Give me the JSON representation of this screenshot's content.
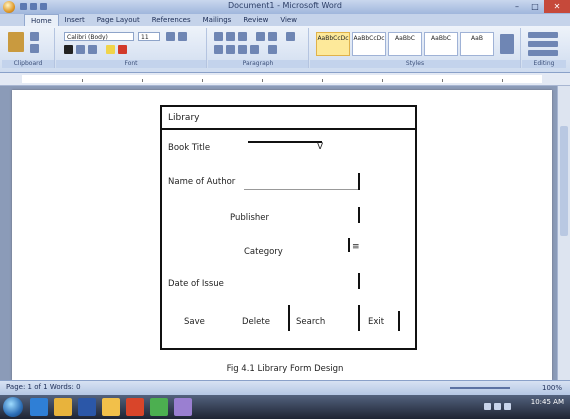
{
  "window": {
    "title": "Document1 - Microsoft Word",
    "controls": {
      "minimize": "–",
      "maximize": "□",
      "close": "✕"
    }
  },
  "ribbon": {
    "tabs": [
      "Home",
      "Insert",
      "Page Layout",
      "References",
      "Mailings",
      "Review",
      "View"
    ],
    "active_tab": "Home",
    "font_name": "Calibri (Body)",
    "font_size": "11",
    "groups": [
      "Clipboard",
      "Font",
      "Paragraph",
      "Styles",
      "Editing"
    ],
    "styles": [
      "AaBbCcDc",
      "AaBbCcDc",
      "AaBbC",
      "AaBbC",
      "AaB"
    ]
  },
  "dialog": {
    "title": "Library",
    "fields": [
      {
        "label": "Book Title"
      },
      {
        "label": "Name of Author"
      },
      {
        "label": "Publisher"
      },
      {
        "label": "Category"
      },
      {
        "label": "Date of Issue"
      }
    ],
    "dropdown_marker": "V",
    "buttons": [
      "Save",
      "Delete",
      "Search",
      "Exit"
    ]
  },
  "caption": "Fig 4.1 Library Form Design",
  "statusbar": {
    "left": "Page: 1 of 1   Words: 0",
    "zoom": "100%"
  },
  "taskbar": {
    "time": "10:45 AM",
    "icons": [
      "ie-icon",
      "explorer-icon",
      "word-icon",
      "folder-icon",
      "media-icon",
      "paint-icon",
      "camera-icon"
    ],
    "icon_colors": [
      "#2f7fd6",
      "#e8b33c",
      "#2b57a8",
      "#f2c04a",
      "#d9452a",
      "#4caf50",
      "#9a7fd1"
    ]
  }
}
